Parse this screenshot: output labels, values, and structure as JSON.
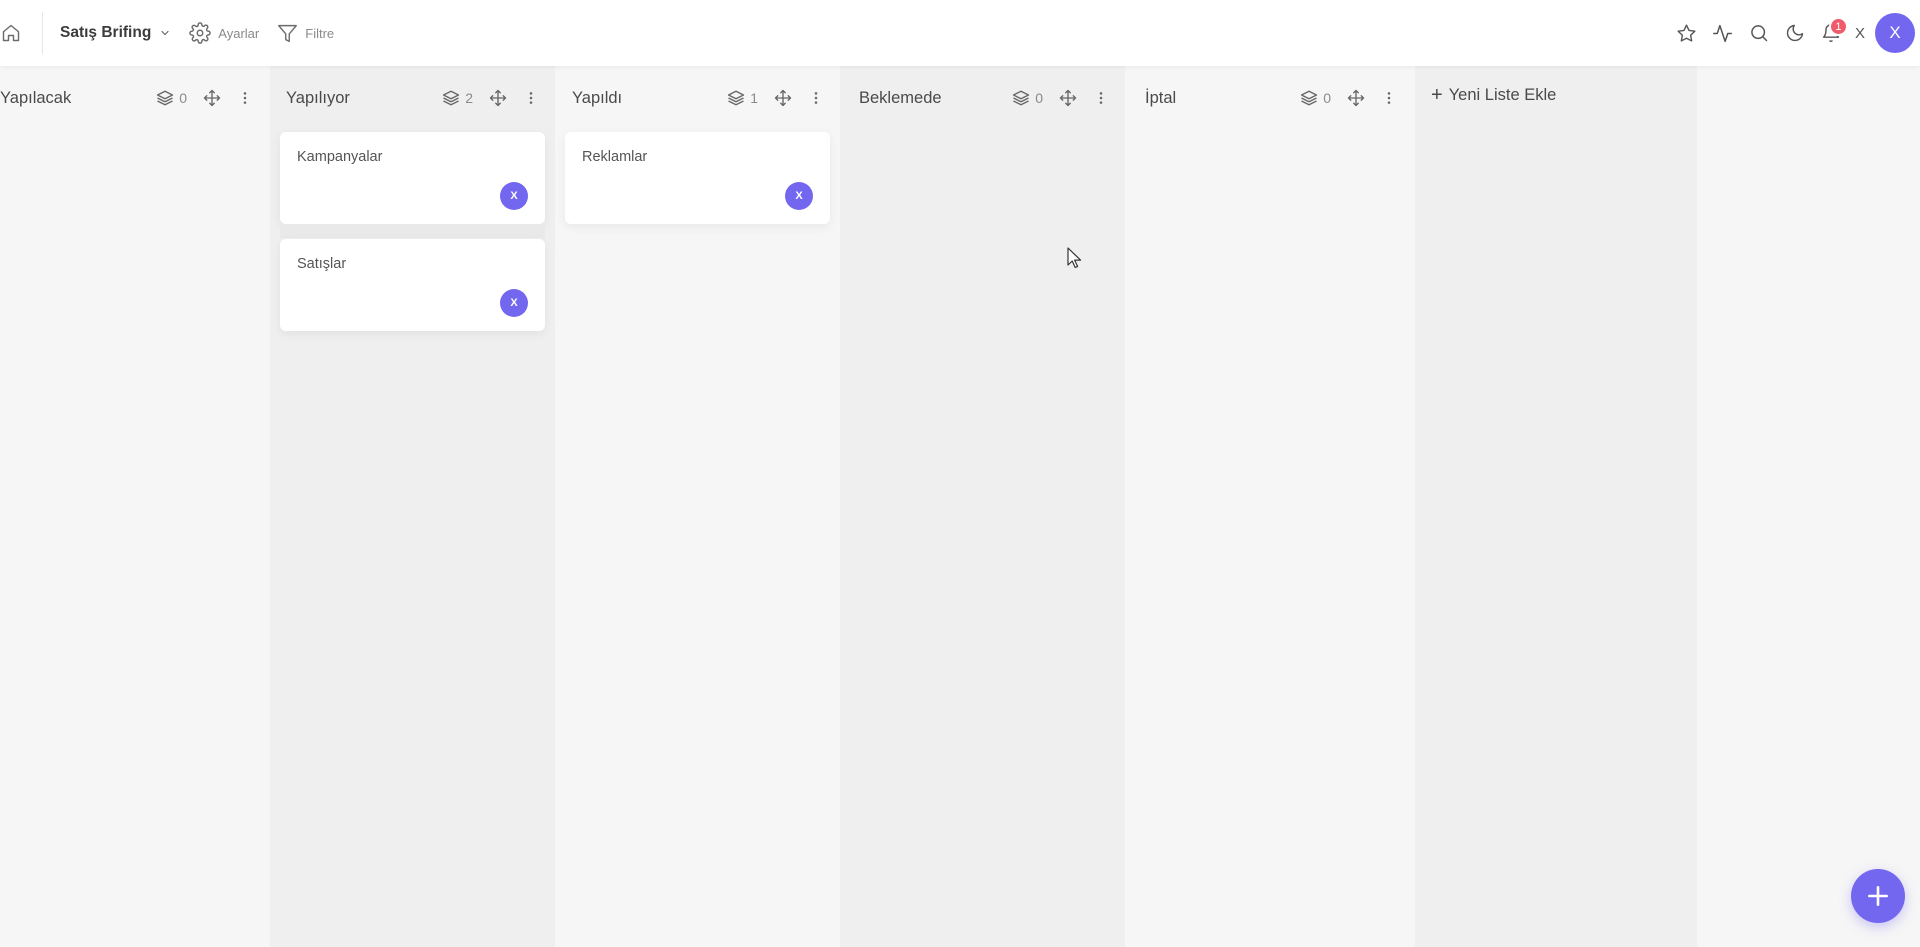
{
  "header": {
    "board_title": "Satış Brifing",
    "settings_label": "Ayarlar",
    "filter_label": "Filtre",
    "notification_count": "1",
    "user_initial": "X",
    "avatar_initial": "X"
  },
  "lists": [
    {
      "title": "Yapılacak",
      "count": "0",
      "cards": []
    },
    {
      "title": "Yapılıyor",
      "count": "2",
      "cards": [
        {
          "title": "Kampanyalar",
          "assignee": "X"
        },
        {
          "title": "Satışlar",
          "assignee": "X"
        }
      ]
    },
    {
      "title": "Yapıldı",
      "count": "1",
      "cards": [
        {
          "title": "Reklamlar",
          "assignee": "X"
        }
      ]
    },
    {
      "title": "Beklemede",
      "count": "0",
      "cards": []
    },
    {
      "title": "İptal",
      "count": "0",
      "cards": []
    }
  ],
  "add_list_label": "Yeni Liste Ekle",
  "colors": {
    "accent": "#7367f0",
    "badge": "#ef5b6b"
  }
}
